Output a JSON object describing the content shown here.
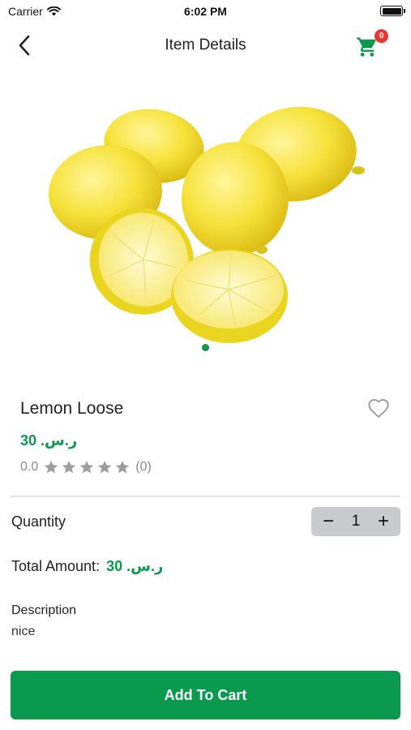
{
  "status_bar": {
    "carrier": "Carrier",
    "time": "6:02 PM"
  },
  "header": {
    "title": "Item Details",
    "cart_count": "0"
  },
  "product": {
    "name": "Lemon Loose",
    "price": "ر.س. 30",
    "rating_value": "0.0",
    "rating_count": "(0)",
    "stars_filled": 0,
    "stars_total": 5,
    "image_icon": "lemons-image",
    "gallery_pages": 1,
    "gallery_active": 1
  },
  "quantity": {
    "label": "Quantity",
    "value": "1",
    "minus": "−",
    "plus": "+"
  },
  "total": {
    "label": "Total Amount:",
    "value": "ر.س. 30"
  },
  "description": {
    "label": "Description",
    "text": "nice"
  },
  "actions": {
    "add_to_cart": "Add To Cart"
  },
  "colors": {
    "accent": "#0a9a4e",
    "badge": "#e53935",
    "stepper_bg": "#c9cacd"
  }
}
